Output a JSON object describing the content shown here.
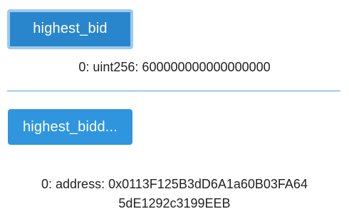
{
  "functions": [
    {
      "button_label": "highest_bid",
      "output": "0: uint256: 600000000000000000"
    },
    {
      "button_label": "highest_bidd...",
      "output_line1": "0: address: 0x0113F125B3dD6A1a60B03FA64",
      "output_line2": "5dE1292c3199EEB"
    }
  ],
  "colors": {
    "button_bg": "#2a86cc",
    "button_focus_ring": "#9ccaee",
    "divider": "#4a9ee0",
    "text": "#222222"
  }
}
